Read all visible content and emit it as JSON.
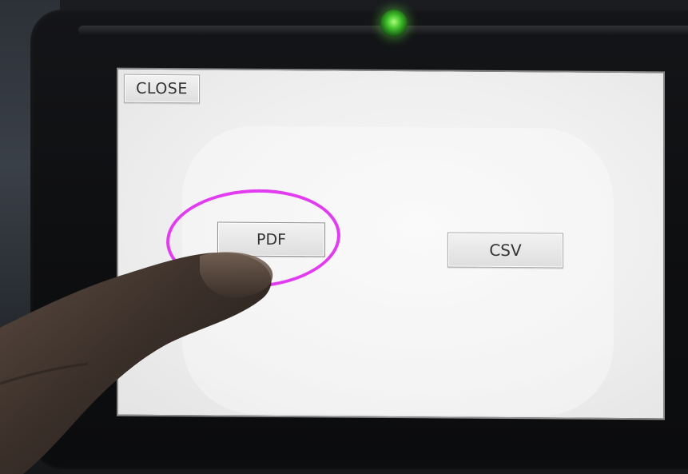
{
  "screen": {
    "close_label": "CLOSE",
    "pdf_label": "PDF",
    "csv_label": "CSV"
  },
  "annotation": {
    "ring_color": "#e23cf0",
    "led_color": "#3fbf2a"
  },
  "icons": {
    "led": "status-led-icon",
    "hand": "pointing-finger"
  }
}
